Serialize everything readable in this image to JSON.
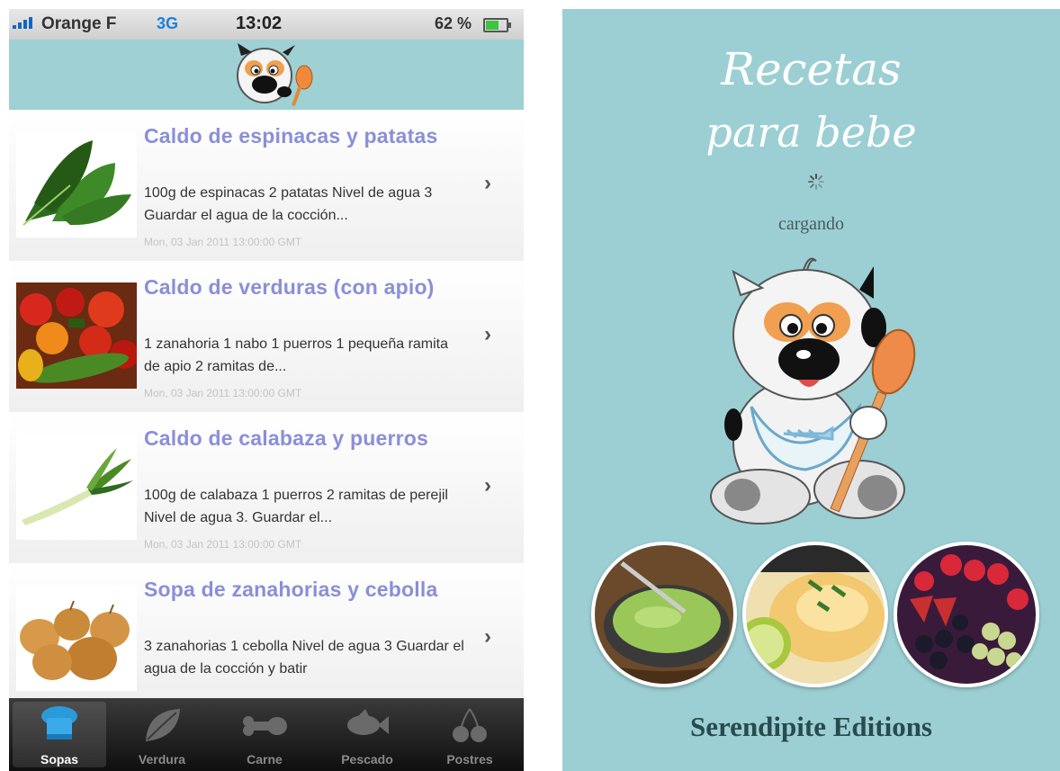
{
  "status_bar": {
    "carrier": "Orange F",
    "network": "3G",
    "time": "13:02",
    "battery": "62 %",
    "battery_level": 0.62
  },
  "recipes": [
    {
      "title": "Caldo de espinacas y patatas",
      "description": "100g de espinacas 2 patatas Nivel de agua 3 Guardar el agua de la cocción...",
      "date": "Mon, 03 Jan 2011 13:00:00 GMT"
    },
    {
      "title": "Caldo de verduras (con apio)",
      "description": "1 zanahoria 1 nabo 1 puerros 1 pequeña ramita de apio 2 ramitas de...",
      "date": "Mon, 03 Jan 2011 13:00:00 GMT"
    },
    {
      "title": "Caldo de calabaza y puerros",
      "description": "100g de calabaza 1 puerros 2 ramitas de perejil Nivel de agua 3. Guardar el...",
      "date": "Mon, 03 Jan 2011 13:00:00 GMT"
    },
    {
      "title": "Sopa de zanahorias y cebolla",
      "description": "3 zanahorias 1 cebolla Nivel de agua 3 Guardar el agua de la cocción y batir",
      "date": ""
    }
  ],
  "tabs": [
    {
      "label": "Sopas",
      "icon": "chef-hat-icon",
      "active": true
    },
    {
      "label": "Verdura",
      "icon": "leaf-icon",
      "active": false
    },
    {
      "label": "Carne",
      "icon": "bone-icon",
      "active": false
    },
    {
      "label": "Pescado",
      "icon": "fish-icon",
      "active": false
    },
    {
      "label": "Postres",
      "icon": "cherries-icon",
      "active": false
    }
  ],
  "splash": {
    "title_line1": "Recetas",
    "title_line2": "para bebe",
    "loading_text": "cargando",
    "publisher": "Serendipite Editions"
  },
  "colors": {
    "header_bg": "#9ed0d4",
    "splash_bg": "#9ccfd3",
    "title_purple": "#8a8fd8"
  }
}
